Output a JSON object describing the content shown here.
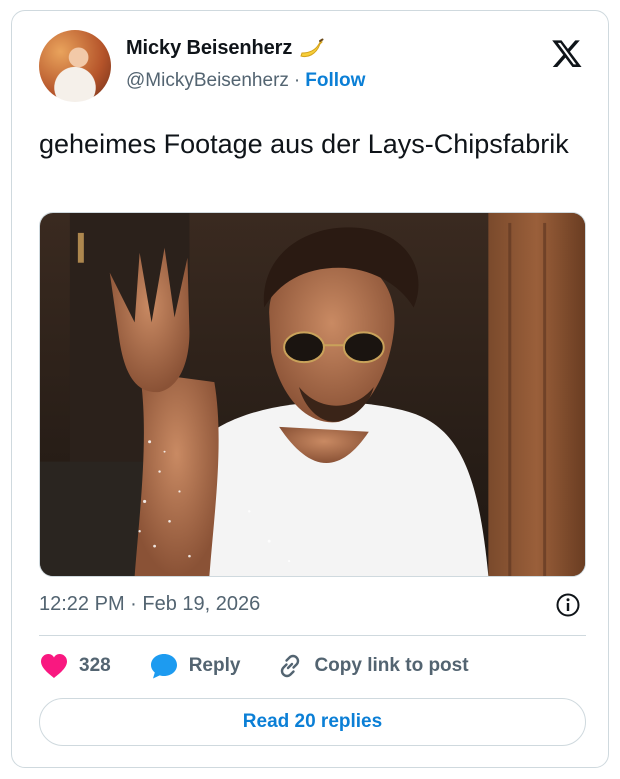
{
  "author": {
    "name": "Micky Beisenherz",
    "emoji_icon": "banana-icon",
    "handle": "@MickyBeisenherz",
    "separator": "·",
    "follow_label": "Follow"
  },
  "platform_icon": "x-logo-icon",
  "tweet": {
    "text": "geheimes Footage aus der Lays-Chipsfabrik"
  },
  "meta": {
    "timestamp": "12:22 PM · Feb 19, 2026",
    "info_icon": "info-icon"
  },
  "actions": {
    "like_count": "328",
    "reply_label": "Reply",
    "copy_label": "Copy link to post"
  },
  "read_replies_label": "Read 20 replies",
  "colors": {
    "accent": "#0b7fd6",
    "like": "#f91880",
    "reply_icon": "#1d9bf0",
    "muted": "#536471",
    "border": "#cfd9de"
  }
}
